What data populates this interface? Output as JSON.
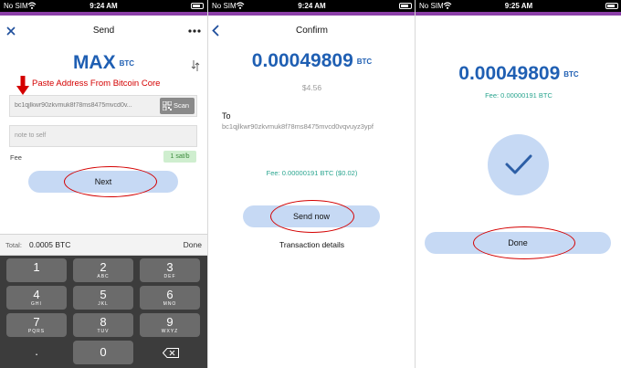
{
  "panel_send": {
    "status": {
      "carrier": "No SIM",
      "time": "9:24 AM"
    },
    "title": "Send",
    "amount_value": "MAX",
    "amount_unit": "BTC",
    "annotation": "Paste Address From Bitcoin Core",
    "address_value": "bc1qjlkwr90zkvmuk8f78ms8475mvcd0v...",
    "scan_label": "Scan",
    "memo_placeholder": "note to self",
    "fee_label": "Fee",
    "fee_value": "1 sat/b",
    "next_label": "Next",
    "total_label": "Total:",
    "total_value": "0.0005 BTC",
    "done_label": "Done",
    "keys": [
      {
        "num": "1",
        "letters": ""
      },
      {
        "num": "2",
        "letters": "ABC"
      },
      {
        "num": "3",
        "letters": "DEF"
      },
      {
        "num": "4",
        "letters": "GHI"
      },
      {
        "num": "5",
        "letters": "JKL"
      },
      {
        "num": "6",
        "letters": "MNO"
      },
      {
        "num": "7",
        "letters": "PQRS"
      },
      {
        "num": "8",
        "letters": "TUV"
      },
      {
        "num": "9",
        "letters": "WXYZ"
      }
    ],
    "dot_key": ".",
    "zero_key": "0"
  },
  "panel_confirm": {
    "status": {
      "carrier": "No SIM",
      "time": "9:24 AM"
    },
    "title": "Confirm",
    "amount_value": "0.00049809",
    "amount_unit": "BTC",
    "fiat_value": "$4.56",
    "to_label": "To",
    "to_address": "bc1qjlkwr90zkvmuk8f78ms8475mvcd0vqvuyz3ypf",
    "fee_text": "Fee: 0.00000191 BTC ($0.02)",
    "send_label": "Send now",
    "details_label": "Transaction details"
  },
  "panel_done": {
    "status": {
      "carrier": "No SIM",
      "time": "9:25 AM"
    },
    "amount_value": "0.00049809",
    "amount_unit": "BTC",
    "fee_text": "Fee: 0.00000191 BTC",
    "done_label": "Done"
  },
  "colors": {
    "accent_bar": "#8b3fa8",
    "amount_blue": "#1f5fb3",
    "fee_teal": "#2aa58f",
    "annotation_red": "#d40000",
    "button_fill": "#c6d9f4"
  }
}
